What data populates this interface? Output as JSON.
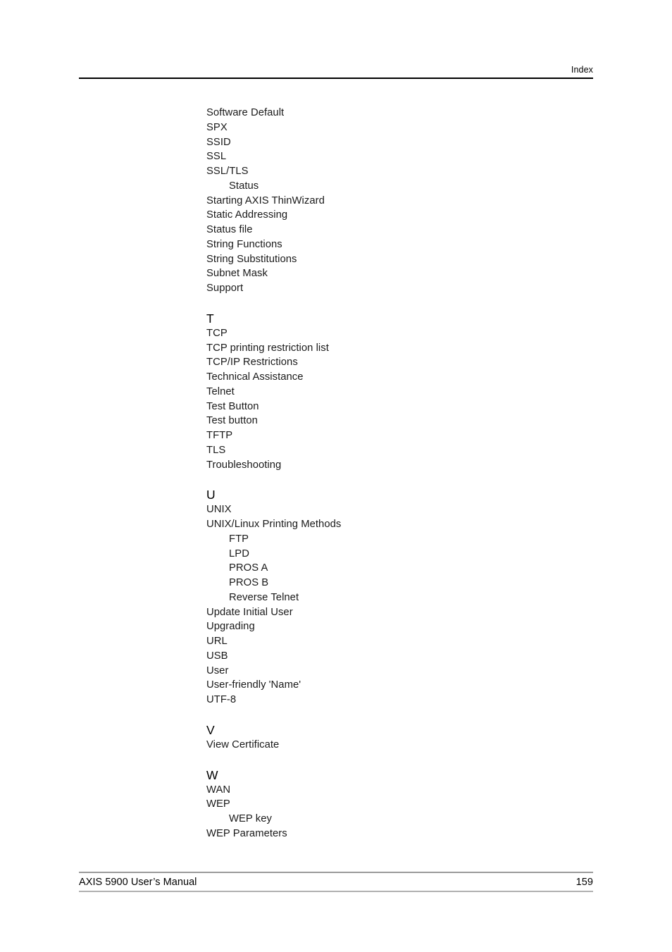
{
  "header": {
    "label": "Index"
  },
  "index": {
    "sections": [
      {
        "letter": "",
        "entries": [
          {
            "text": "Software Default",
            "level": 0
          },
          {
            "text": "SPX",
            "level": 0
          },
          {
            "text": "SSID",
            "level": 0
          },
          {
            "text": "SSL",
            "level": 0
          },
          {
            "text": "SSL/TLS",
            "level": 0
          },
          {
            "text": "Status",
            "level": 1
          },
          {
            "text": "Starting AXIS ThinWizard",
            "level": 0
          },
          {
            "text": "Static Addressing",
            "level": 0
          },
          {
            "text": "Status file",
            "level": 0
          },
          {
            "text": "String Functions",
            "level": 0
          },
          {
            "text": "String Substitutions",
            "level": 0
          },
          {
            "text": "Subnet Mask",
            "level": 0
          },
          {
            "text": "Support",
            "level": 0
          }
        ]
      },
      {
        "letter": "T",
        "entries": [
          {
            "text": "TCP",
            "level": 0
          },
          {
            "text": "TCP printing restriction list",
            "level": 0
          },
          {
            "text": "TCP/IP Restrictions",
            "level": 0
          },
          {
            "text": "Technical Assistance",
            "level": 0
          },
          {
            "text": "Telnet",
            "level": 0
          },
          {
            "text": "Test Button",
            "level": 0
          },
          {
            "text": "Test button",
            "level": 0
          },
          {
            "text": "TFTP",
            "level": 0
          },
          {
            "text": "TLS",
            "level": 0
          },
          {
            "text": "Troubleshooting",
            "level": 0
          }
        ]
      },
      {
        "letter": "U",
        "entries": [
          {
            "text": "UNIX",
            "level": 0
          },
          {
            "text": "UNIX/Linux Printing Methods",
            "level": 0
          },
          {
            "text": "FTP",
            "level": 1
          },
          {
            "text": "LPD",
            "level": 1
          },
          {
            "text": "PROS A",
            "level": 1
          },
          {
            "text": "PROS B",
            "level": 1
          },
          {
            "text": "Reverse Telnet",
            "level": 1
          },
          {
            "text": "Update Initial User",
            "level": 0
          },
          {
            "text": "Upgrading",
            "level": 0
          },
          {
            "text": "URL",
            "level": 0
          },
          {
            "text": "USB",
            "level": 0
          },
          {
            "text": "User",
            "level": 0
          },
          {
            "text": "User-friendly 'Name'",
            "level": 0
          },
          {
            "text": "UTF-8",
            "level": 0
          }
        ]
      },
      {
        "letter": "V",
        "entries": [
          {
            "text": "View Certificate",
            "level": 0
          }
        ]
      },
      {
        "letter": "W",
        "entries": [
          {
            "text": "WAN",
            "level": 0
          },
          {
            "text": "WEP",
            "level": 0
          },
          {
            "text": "WEP key",
            "level": 1
          },
          {
            "text": "WEP Parameters",
            "level": 0
          }
        ]
      }
    ]
  },
  "footer": {
    "title": "AXIS 5900 User’s Manual",
    "page_number": "159"
  }
}
